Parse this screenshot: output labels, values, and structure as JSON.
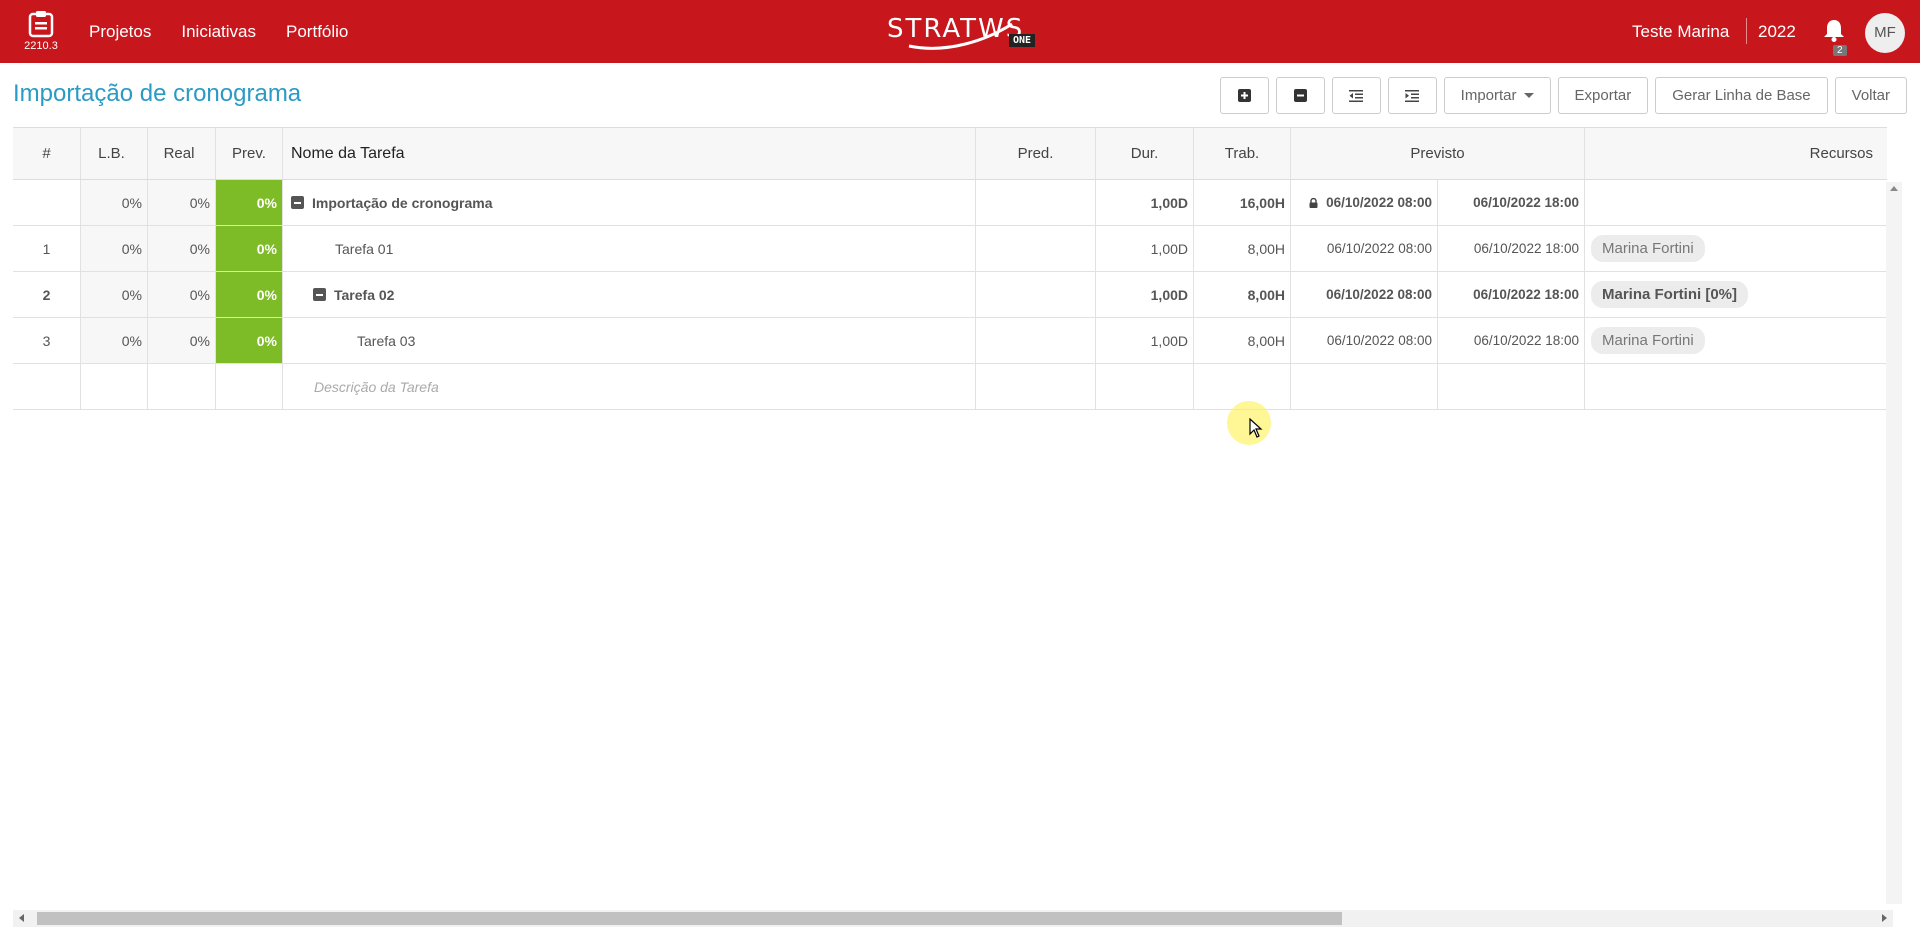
{
  "app": {
    "version": "2210.3",
    "nav": [
      "Projetos",
      "Iniciativas",
      "Portfólio"
    ],
    "logo_text": "STRATWS",
    "logo_badge": "ONE",
    "user_name": "Teste Marina",
    "year": "2022",
    "notification_count": "2",
    "avatar_initials": "MF",
    "accent_color": "#c8161d"
  },
  "page": {
    "title": "Importação de cronograma",
    "toolbar": {
      "importar": "Importar",
      "exportar": "Exportar",
      "gerar_linha_base": "Gerar Linha de Base",
      "voltar": "Voltar"
    }
  },
  "grid": {
    "headers": {
      "num": "#",
      "lb": "L.B.",
      "real": "Real",
      "prev": "Prev.",
      "name": "Nome da Tarefa",
      "pred": "Pred.",
      "dur": "Dur.",
      "trab": "Trab.",
      "previsto": "Previsto",
      "recursos": "Recursos"
    },
    "rows": [
      {
        "num": "",
        "lb": "0%",
        "real": "0%",
        "prev": "0%",
        "name": "Importação de cronograma",
        "pred": "",
        "dur": "1,00D",
        "trab": "16,00H",
        "start": "06/10/2022 08:00",
        "end": "06/10/2022 18:00",
        "resource": ""
      },
      {
        "num": "1",
        "lb": "0%",
        "real": "0%",
        "prev": "0%",
        "name": "Tarefa 01",
        "pred": "",
        "dur": "1,00D",
        "trab": "8,00H",
        "start": "06/10/2022 08:00",
        "end": "06/10/2022 18:00",
        "resource": "Marina Fortini"
      },
      {
        "num": "2",
        "lb": "0%",
        "real": "0%",
        "prev": "0%",
        "name": "Tarefa 02",
        "pred": "",
        "dur": "1,00D",
        "trab": "8,00H",
        "start": "06/10/2022 08:00",
        "end": "06/10/2022 18:00",
        "resource": "Marina Fortini [0%]"
      },
      {
        "num": "3",
        "lb": "0%",
        "real": "0%",
        "prev": "0%",
        "name": "Tarefa 03",
        "pred": "",
        "dur": "1,00D",
        "trab": "8,00H",
        "start": "06/10/2022 08:00",
        "end": "06/10/2022 18:00",
        "resource": "Marina Fortini"
      }
    ],
    "new_row_placeholder": "Descrição da Tarefa",
    "progress_color": "#7dbb27"
  }
}
